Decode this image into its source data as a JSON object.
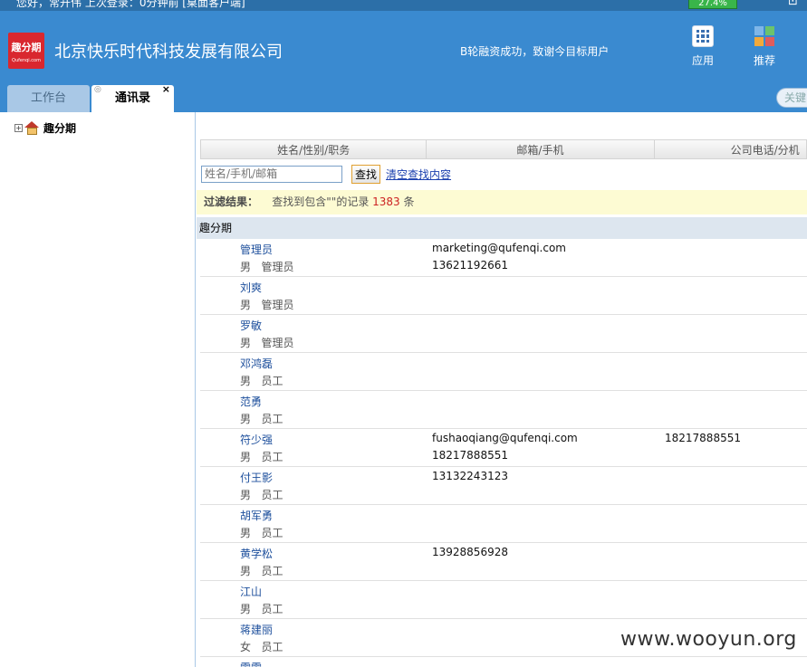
{
  "top_strip": {
    "notice": "您好，常开伟 上次登录：0分钟前 [桌面客户端]",
    "battery": "27.4%",
    "corner_glyph": "⊡"
  },
  "header": {
    "logo_text": "趣分期",
    "logo_sub": "Qufenqi.com",
    "company": "北京快乐时代科技发展有限公司",
    "slogan": "B轮融资成功，致谢今目标用户",
    "apps_label": "应用",
    "recommend_label": "推荐"
  },
  "tabs": [
    {
      "label": "工作台"
    },
    {
      "label": "通讯录"
    }
  ],
  "keyword_search": "关键",
  "tree": {
    "root_label": "趣分期",
    "toggle": "+"
  },
  "columns": [
    "姓名/性别/职务",
    "邮箱/手机",
    "公司电话/分机"
  ],
  "search": {
    "placeholder": "姓名/手机/邮箱",
    "button": "查找",
    "clear": "清空查找内容"
  },
  "filter": {
    "label": "过滤结果：",
    "text_before": "查找到包含\"\"的记录",
    "count": "1383",
    "text_after": "条"
  },
  "group": "趣分期",
  "rows": [
    {
      "name": "管理员",
      "meta": "男   管理员",
      "email": "marketing@qufenqi.com",
      "mobile": "13621192661",
      "phone2": ""
    },
    {
      "name": "刘爽",
      "meta": "男   管理员",
      "email": "",
      "mobile": "",
      "phone2": ""
    },
    {
      "name": "罗敏",
      "meta": "男   管理员",
      "email": "",
      "mobile": "",
      "phone2": ""
    },
    {
      "name": "邓鸿磊",
      "meta": "男   员工",
      "email": "",
      "mobile": "",
      "phone2": ""
    },
    {
      "name": "范勇",
      "meta": "男   员工",
      "email": "",
      "mobile": "",
      "phone2": ""
    },
    {
      "name": "符少强",
      "meta": "男   员工",
      "email": "fushaoqiang@qufenqi.com",
      "mobile": "18217888551",
      "phone2": "18217888551"
    },
    {
      "name": "付王影",
      "meta": "男   员工",
      "email": "13132243123",
      "mobile": "",
      "phone2": ""
    },
    {
      "name": "胡军勇",
      "meta": "男   员工",
      "email": "",
      "mobile": "",
      "phone2": ""
    },
    {
      "name": "黄学松",
      "meta": "男   员工",
      "email": "13928856928",
      "mobile": "",
      "phone2": ""
    },
    {
      "name": "江山",
      "meta": "男   员工",
      "email": "",
      "mobile": "",
      "phone2": ""
    },
    {
      "name": "蒋建丽",
      "meta": "女   员工",
      "email": "",
      "mobile": "",
      "phone2": ""
    },
    {
      "name": "雷雷",
      "meta": "",
      "email": "",
      "mobile": "",
      "phone2": ""
    }
  ],
  "watermark": "www.wooyun.org",
  "colors": {
    "header_bg": "#3a8ad0",
    "logo_red": "#d9272e",
    "link_blue": "#1d4f9c",
    "filter_bg": "#fdfbd3",
    "count_red": "#cc2222"
  }
}
